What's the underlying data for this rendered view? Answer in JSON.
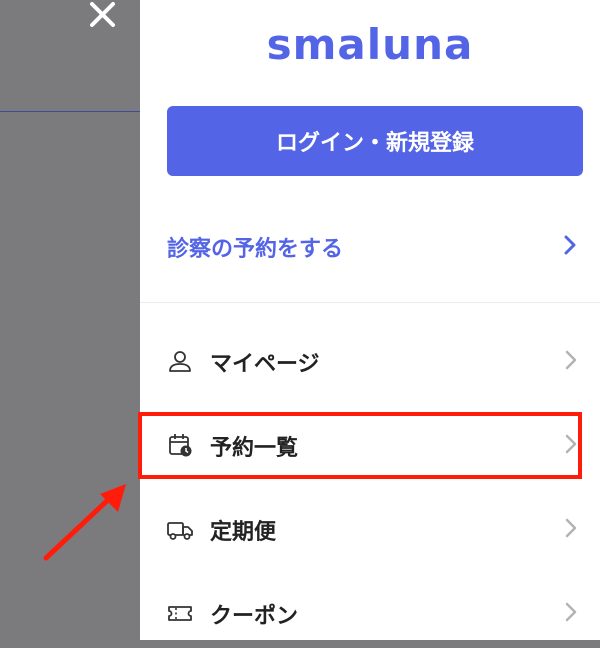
{
  "brand": {
    "logo_text": "smaluna",
    "accent_color": "#5464e6"
  },
  "header": {
    "close_icon": "close-icon"
  },
  "login": {
    "label": "ログイン・新規登録"
  },
  "reserve": {
    "label": "診察の予約をする",
    "icon": "chevron-right-icon"
  },
  "menu": {
    "items": [
      {
        "label": "マイページ",
        "icon": "user-icon"
      },
      {
        "label": "予約一覧",
        "icon": "calendar-clock-icon"
      },
      {
        "label": "定期便",
        "icon": "truck-icon"
      },
      {
        "label": "クーポン",
        "icon": "ticket-icon"
      }
    ]
  },
  "annotation": {
    "highlight_color": "#ff1c0a",
    "highlighted_item": "予約一覧"
  }
}
